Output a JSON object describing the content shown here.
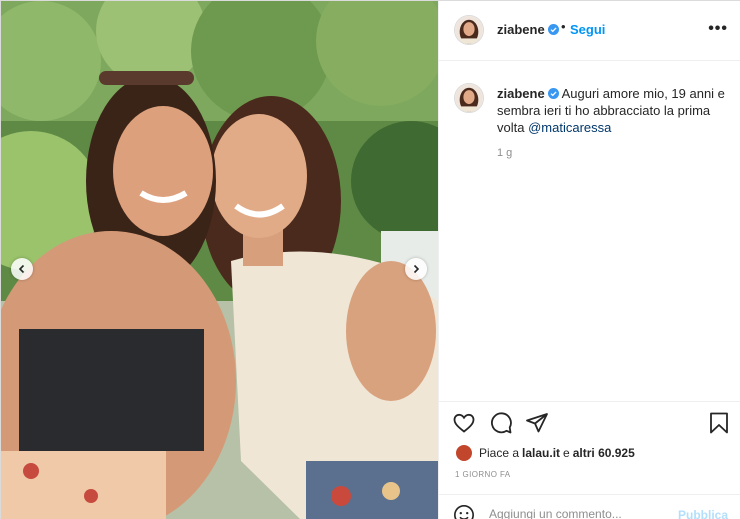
{
  "post": {
    "username": "ziabene",
    "follow_label": "Segui",
    "separator": "•",
    "more_label": "•••",
    "caption": {
      "username": "ziabene",
      "text": "Auguri amore mio, 19 anni e sembra ieri ti ho abbracciato la prima volta",
      "mention": "@maticaressa",
      "time": "1 g"
    },
    "likes": {
      "prefix": "Piace a",
      "liker": "lalau.it",
      "conjunction": "e",
      "others": "altri 60.925"
    },
    "date": "1 GIORNO FA",
    "comment": {
      "placeholder": "Aggiungi un commento...",
      "publish_label": "Pubblica"
    }
  },
  "colors": {
    "link_blue": "#0095f6",
    "mention_blue": "#00376b",
    "publish_disabled": "#b2dffc",
    "secondary_text": "#8e8e8e"
  },
  "icons": [
    "chevron-left-icon",
    "chevron-right-icon",
    "verified-icon",
    "more-icon",
    "heart-icon",
    "comment-icon",
    "share-icon",
    "bookmark-icon",
    "emoji-icon"
  ]
}
